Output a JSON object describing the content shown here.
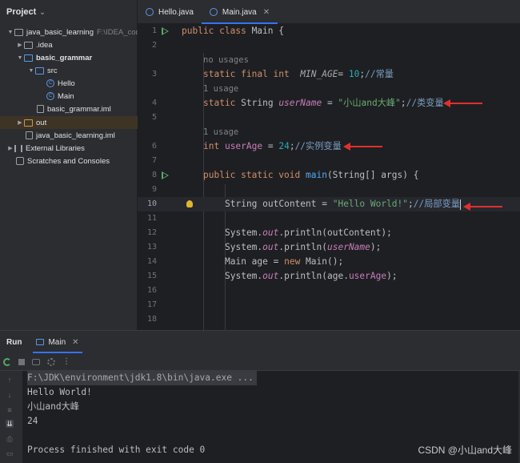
{
  "project_panel": {
    "title": "Project",
    "tree": [
      {
        "label": "java_basic_learning",
        "hint": "F:\\IDEA_code",
        "icon": "folder-icon",
        "level": 0,
        "expanded": true
      },
      {
        "label": ".idea",
        "icon": "folder-icon",
        "level": 1,
        "expanded": false
      },
      {
        "label": "basic_grammar",
        "icon": "module-folder-icon",
        "level": 1,
        "expanded": true
      },
      {
        "label": "src",
        "icon": "source-folder-icon",
        "level": 2,
        "expanded": true
      },
      {
        "label": "Hello",
        "icon": "java-class-icon",
        "level": 3
      },
      {
        "label": "Main",
        "icon": "java-class-icon",
        "level": 3
      },
      {
        "label": "basic_grammar.iml",
        "icon": "iml-file-icon",
        "level": 2
      },
      {
        "label": "out",
        "icon": "excluded-folder-icon",
        "level": 1,
        "expanded": false
      },
      {
        "label": "java_basic_learning.iml",
        "icon": "iml-file-icon",
        "level": 1
      },
      {
        "label": "External Libraries",
        "icon": "libraries-icon",
        "level": 0,
        "expanded": false
      },
      {
        "label": "Scratches and Consoles",
        "icon": "scratches-icon",
        "level": 0
      }
    ]
  },
  "editor_tabs": [
    {
      "label": "Hello.java",
      "active": false
    },
    {
      "label": "Main.java",
      "active": true
    }
  ],
  "editor": {
    "line_numbers": [
      "1",
      "2",
      "3",
      "4",
      "5",
      "6",
      "7",
      "8",
      "9",
      "10",
      "11",
      "12",
      "13",
      "14",
      "15",
      "16",
      "17",
      "18"
    ],
    "current_line": "10",
    "hints": {
      "h3": "no usages",
      "h4": "1 usage",
      "h6": "1 usage"
    },
    "code": {
      "l1": {
        "kw": "public class ",
        "name": "Main {"
      },
      "l3": {
        "kw": "static final int ",
        "const": "MIN_AGE",
        "eq": "= ",
        "num": "10",
        "semi": ";",
        "cmt": "//常量"
      },
      "l4": {
        "kw": "static ",
        "type": "String ",
        "field": "userName",
        "eq": " = ",
        "str": "\"小山and大峰\"",
        "semi": ";",
        "cmt": "//类变量"
      },
      "l6": {
        "kw": "int ",
        "field": "userAge",
        "eq": " = ",
        "num": "24",
        "semi": ";",
        "cmt": "//实例变量"
      },
      "l8": {
        "kw": "public static void ",
        "fn": "main",
        "rest": "(String[] args) {"
      },
      "l10": {
        "type": "String outContent = ",
        "str": "\"Hello World!\"",
        "semi": ";",
        "cmt": "//局部变量"
      },
      "l12": {
        "a": "System.",
        "b": "out",
        "c": ".println(outContent);"
      },
      "l13": {
        "a": "System.",
        "b": "out",
        "c": ".println(",
        "d": "userName",
        "e": ");"
      },
      "l14": {
        "a": "Main age = ",
        "kw": "new ",
        "b": "Main();"
      },
      "l15": {
        "a": "System.",
        "b": "out",
        "c": ".println(age.",
        "d": "userAge",
        "e": ");"
      }
    }
  },
  "run_panel": {
    "title": "Run",
    "tab_label": "Main",
    "console": [
      "F:\\JDK\\environment\\jdk1.8\\bin\\java.exe ...",
      "Hello World!",
      "小山and大峰",
      "24",
      "",
      "Process finished with exit code 0"
    ]
  },
  "watermark": "CSDN @小山and大峰",
  "colors": {
    "keyword": "#cf8e6d",
    "string": "#6aab73",
    "number": "#2aacb8",
    "field": "#c77dbb",
    "comment": "#7a9ec2",
    "annotation_arrow": "#e0302d",
    "accent": "#3574f0"
  }
}
